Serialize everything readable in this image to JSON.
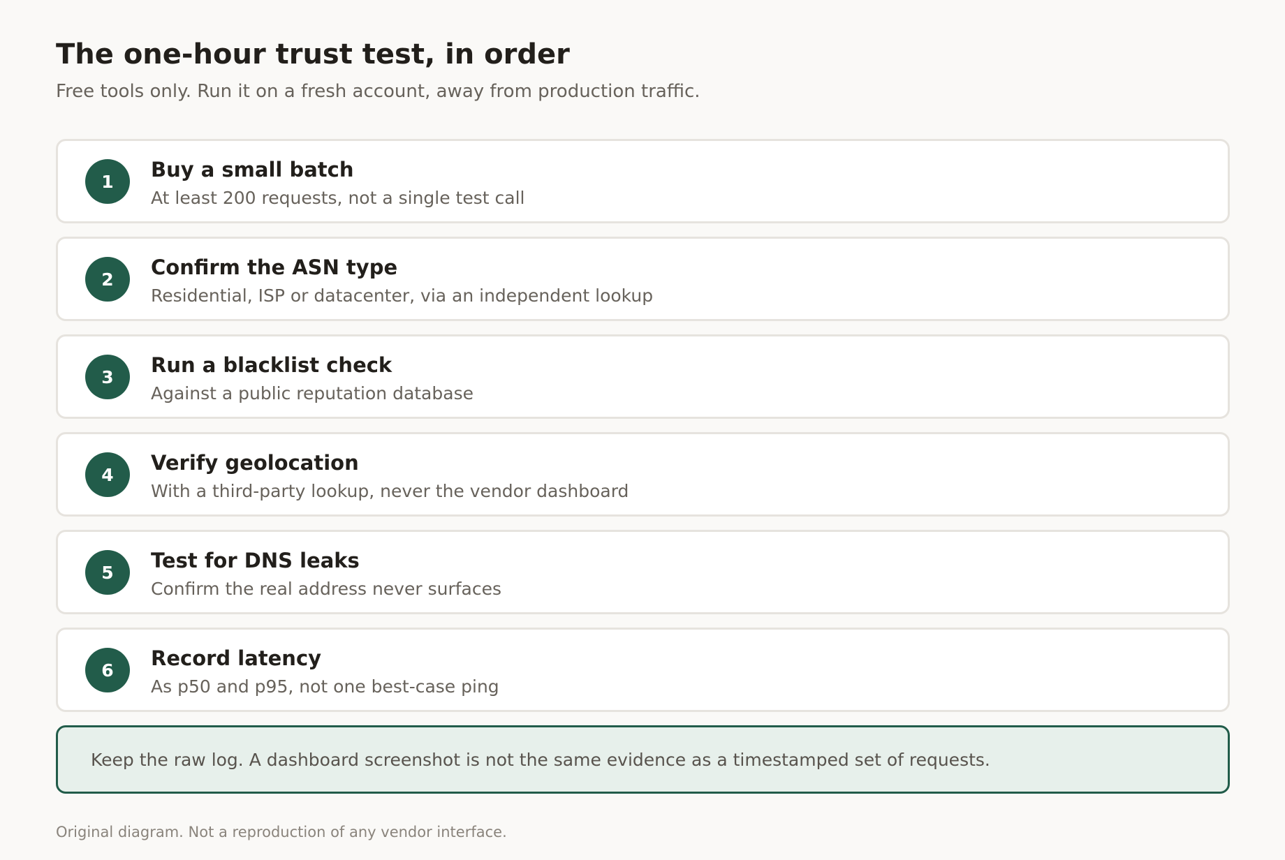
{
  "header": {
    "title": "The one-hour trust test, in order",
    "subtitle": "Free tools only. Run it on a fresh account, away from production traffic."
  },
  "steps": [
    {
      "number": "1",
      "title": "Buy a small batch",
      "description": "At least 200 requests, not a single test call"
    },
    {
      "number": "2",
      "title": "Confirm the ASN type",
      "description": "Residential, ISP or datacenter, via an independent lookup"
    },
    {
      "number": "3",
      "title": "Run a blacklist check",
      "description": "Against a public reputation database"
    },
    {
      "number": "4",
      "title": "Verify geolocation",
      "description": "With a third-party lookup, never the vendor dashboard"
    },
    {
      "number": "5",
      "title": "Test for DNS leaks",
      "description": "Confirm the real address never surfaces"
    },
    {
      "number": "6",
      "title": "Record latency",
      "description": "As p50 and p95, not one best-case ping"
    }
  ],
  "note": {
    "text": "Keep the raw log. A dashboard screenshot is not the same evidence as a timestamped set of requests."
  },
  "footer": {
    "text": "Original diagram. Not a reproduction of any vendor interface."
  },
  "colors": {
    "accent": "#225c4a",
    "note_background": "#e7f0eb",
    "page_background": "#faf9f7"
  }
}
